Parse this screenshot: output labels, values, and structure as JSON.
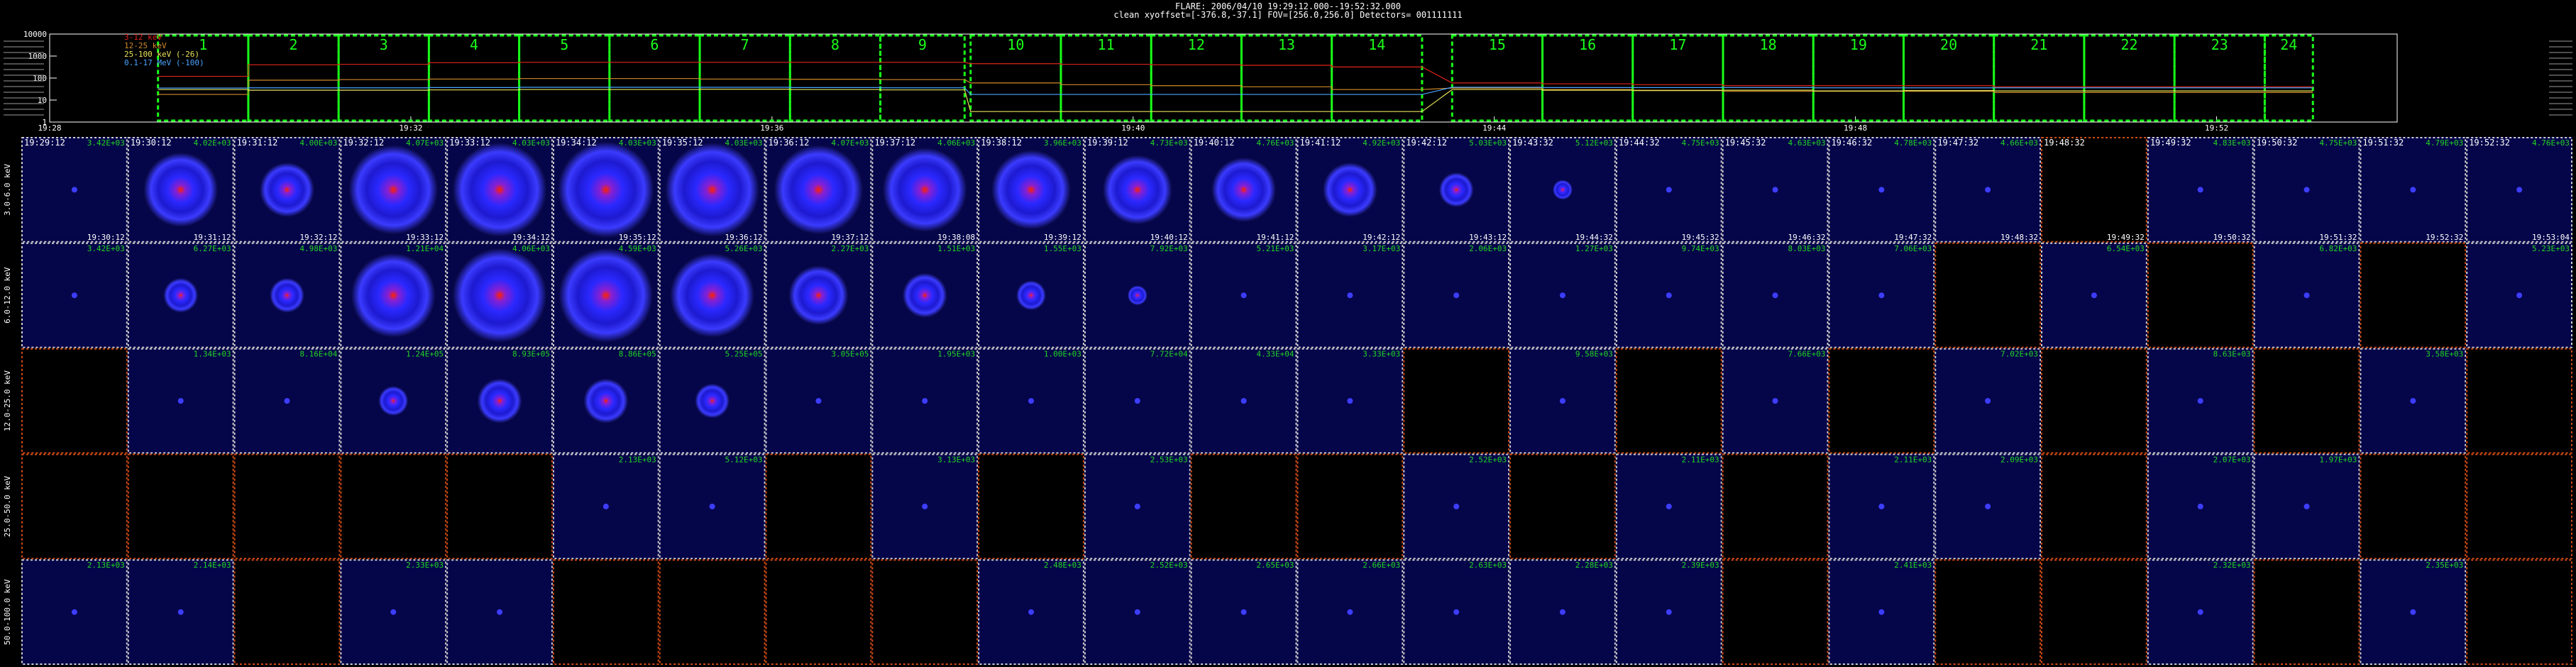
{
  "header": {
    "line1": "FLARE: 2006/04/10 19:29:12.000--19:52:32.000",
    "line2": "clean   xyoffset=[-376.8,-37.1]   FOV=[256.0,256.0]   Detectors= 001111111"
  },
  "lightcurve": {
    "yticks": [
      "10000",
      "1000",
      "100",
      "10",
      "1"
    ],
    "xticks": [
      "19:28",
      "19:32",
      "19:36",
      "19:40",
      "19:44",
      "19:48",
      "19:52"
    ],
    "legend": [
      {
        "label": "3-12 keV",
        "color": "#e0241b"
      },
      {
        "label": "12-25 keV",
        "color": "#d08a2a"
      },
      {
        "label": "25-100 keV (-26)",
        "color": "#e8e35a"
      },
      {
        "label": "0.1-17 MeV (-100)",
        "color": "#4aa3ff"
      }
    ],
    "interval_numbers": [
      "1",
      "2",
      "3",
      "4",
      "5",
      "6",
      "7",
      "8",
      "9",
      "10",
      "11",
      "12",
      "13",
      "14",
      "15",
      "16",
      "17",
      "18",
      "19",
      "20",
      "21",
      "22",
      "23",
      "24"
    ],
    "box_color": "#19ff19"
  },
  "chart_data": {
    "type": "image-grid",
    "time_bins": [
      {
        "start": "19:29:12",
        "end": "19:30:12"
      },
      {
        "start": "19:30:12",
        "end": "19:31:12"
      },
      {
        "start": "19:31:12",
        "end": "19:32:12"
      },
      {
        "start": "19:32:12",
        "end": "19:33:12"
      },
      {
        "start": "19:33:12",
        "end": "19:34:12"
      },
      {
        "start": "19:34:12",
        "end": "19:35:12"
      },
      {
        "start": "19:35:12",
        "end": "19:36:12"
      },
      {
        "start": "19:36:12",
        "end": "19:37:12"
      },
      {
        "start": "19:37:12",
        "end": "19:38:08"
      },
      {
        "start": "19:38:12",
        "end": "19:39:12"
      },
      {
        "start": "19:39:12",
        "end": "19:40:12"
      },
      {
        "start": "19:40:12",
        "end": "19:41:12"
      },
      {
        "start": "19:41:12",
        "end": "19:42:12"
      },
      {
        "start": "19:42:12",
        "end": "19:43:12"
      },
      {
        "start": "19:43:32",
        "end": "19:44:32"
      },
      {
        "start": "19:44:32",
        "end": "19:45:32"
      },
      {
        "start": "19:45:32",
        "end": "19:46:32"
      },
      {
        "start": "19:46:32",
        "end": "19:47:32"
      },
      {
        "start": "19:47:32",
        "end": "19:48:32"
      },
      {
        "start": "19:48:32",
        "end": "19:49:32"
      },
      {
        "start": "19:49:32",
        "end": "19:50:32"
      },
      {
        "start": "19:50:32",
        "end": "19:51:32"
      },
      {
        "start": "19:51:32",
        "end": "19:52:32"
      },
      {
        "start": "19:52:32",
        "end": "19:53:04"
      }
    ],
    "energy_bands": [
      {
        "label": "3.0-6.0 keV",
        "values": [
          "3.42E+03",
          "4.02E+03",
          "4.00E+03",
          "4.07E+03",
          "4.03E+03",
          "4.03E+03",
          "4.03E+03",
          "4.07E+03",
          "4.06E+03",
          "3.96E+03",
          "4.73E+03",
          "4.76E+03",
          "4.92E+03",
          "5.03E+03",
          "5.12E+03",
          "4.75E+03",
          "4.63E+03",
          "4.78E+03",
          "4.66E+03",
          "",
          "4.83E+03",
          "4.75E+03",
          "4.79E+03",
          "4.76E+03"
        ],
        "levels": [
          0.05,
          0.75,
          0.55,
          0.9,
          0.95,
          0.97,
          0.95,
          0.9,
          0.85,
          0.8,
          0.7,
          0.65,
          0.55,
          0.35,
          0.2,
          0.1,
          0.05,
          0.05,
          0.05,
          0,
          0.05,
          0.05,
          0.05,
          0.05
        ]
      },
      {
        "label": "6.0-12.0 keV",
        "values": [
          "3.42E+03",
          "6.27E+03",
          "4.98E+03",
          "1.21E+04",
          "4.06E+03",
          "4.59E+03",
          "5.26E+03",
          "2.27E+03",
          "1.51E+03",
          "1.55E+03",
          "7.92E+03",
          "5.21E+03",
          "3.17E+03",
          "2.06E+03",
          "1.27E+03",
          "9.74E+03",
          "8.03E+03",
          "7.06E+03",
          "",
          "6.54E+03",
          "",
          "6.82E+03",
          "",
          "5.23E+03"
        ],
        "levels": [
          0.05,
          0.35,
          0.35,
          0.85,
          0.95,
          0.95,
          0.85,
          0.6,
          0.45,
          0.3,
          0.2,
          0.15,
          0.1,
          0.05,
          0.05,
          0.05,
          0.05,
          0.05,
          0,
          0.05,
          0,
          0.05,
          0,
          0.05
        ]
      },
      {
        "label": "12.0-25.0 keV",
        "values": [
          "",
          "1.34E+03",
          "8.16E+04",
          "1.24E+05",
          "8.93E+05",
          "8.86E+05",
          "5.25E+05",
          "3.05E+05",
          "1.95E+03",
          "1.00E+03",
          "7.72E+04",
          "4.33E+04",
          "3.33E+03",
          "",
          "9.58E+03",
          "",
          "7.66E+03",
          "",
          "7.02E+03",
          "",
          "8.63E+03",
          "",
          "3.58E+03",
          ""
        ],
        "levels": [
          0,
          0.05,
          0.05,
          0.3,
          0.45,
          0.45,
          0.35,
          0.15,
          0.05,
          0.05,
          0.05,
          0.05,
          0.05,
          0,
          0.05,
          0,
          0.05,
          0,
          0.05,
          0,
          0.05,
          0,
          0.05,
          0
        ]
      },
      {
        "label": "25.0-50.0 keV",
        "values": [
          "",
          "",
          "",
          "",
          "",
          "2.13E+03",
          "5.12E+03",
          "",
          "3.13E+03",
          "",
          "2.53E+03",
          "",
          "",
          "2.52E+03",
          "",
          "2.11E+03",
          "",
          "2.11E+03",
          "2.09E+03",
          "",
          "2.07E+03",
          "1.97E+03",
          "",
          ""
        ],
        "levels": [
          0,
          0,
          0,
          0,
          0,
          0.05,
          0.05,
          0,
          0.05,
          0,
          0.05,
          0,
          0,
          0.05,
          0,
          0.05,
          0,
          0.05,
          0.05,
          0,
          0.05,
          0.05,
          0,
          0
        ]
      },
      {
        "label": "50.0-100.0 keV",
        "values": [
          "2.13E+03",
          "2.14E+03",
          "",
          "2.33E+03",
          "",
          "",
          "",
          "",
          "",
          "2.48E+03",
          "2.52E+03",
          "2.65E+03",
          "2.66E+03",
          "2.63E+03",
          "2.28E+03",
          "2.39E+03",
          "",
          "2.41E+03",
          "",
          "",
          "2.32E+03",
          "",
          "2.35E+03",
          ""
        ],
        "levels": [
          0.1,
          0.1,
          0,
          0.1,
          0.1,
          0,
          0,
          0,
          0,
          0.1,
          0.1,
          0.1,
          0.1,
          0.1,
          0.1,
          0.1,
          0,
          0.1,
          0,
          0,
          0.1,
          0,
          0.1,
          0
        ]
      }
    ],
    "series_curves": [
      {
        "name": "3-12 keV",
        "color": "#e0241b",
        "values": [
          120,
          400,
          420,
          500,
          520,
          520,
          520,
          520,
          520,
          450,
          420,
          400,
          380,
          320,
          60,
          55,
          50,
          45,
          45,
          45,
          40,
          40,
          40,
          40
        ]
      },
      {
        "name": "12-25 keV",
        "color": "#d08a2a",
        "values": [
          18,
          80,
          85,
          90,
          95,
          95,
          90,
          88,
          85,
          60,
          50,
          45,
          40,
          30,
          35,
          30,
          28,
          25,
          25,
          25,
          22,
          22,
          22,
          22
        ]
      },
      {
        "name": "25-100 keV (-26)",
        "color": "#e8e35a",
        "values": [
          30,
          28,
          28,
          29,
          30,
          30,
          31,
          30,
          29,
          3,
          3,
          3,
          3,
          3,
          30,
          28,
          27,
          28,
          26,
          27,
          26,
          26,
          26,
          26
        ]
      },
      {
        "name": "0.1-17 MeV (-100)",
        "color": "#4aa3ff",
        "values": [
          35,
          36,
          36,
          37,
          38,
          38,
          38,
          37,
          36,
          18,
          18,
          18,
          18,
          18,
          38,
          37,
          37,
          37,
          36,
          36,
          36,
          36,
          36,
          36
        ]
      }
    ]
  }
}
